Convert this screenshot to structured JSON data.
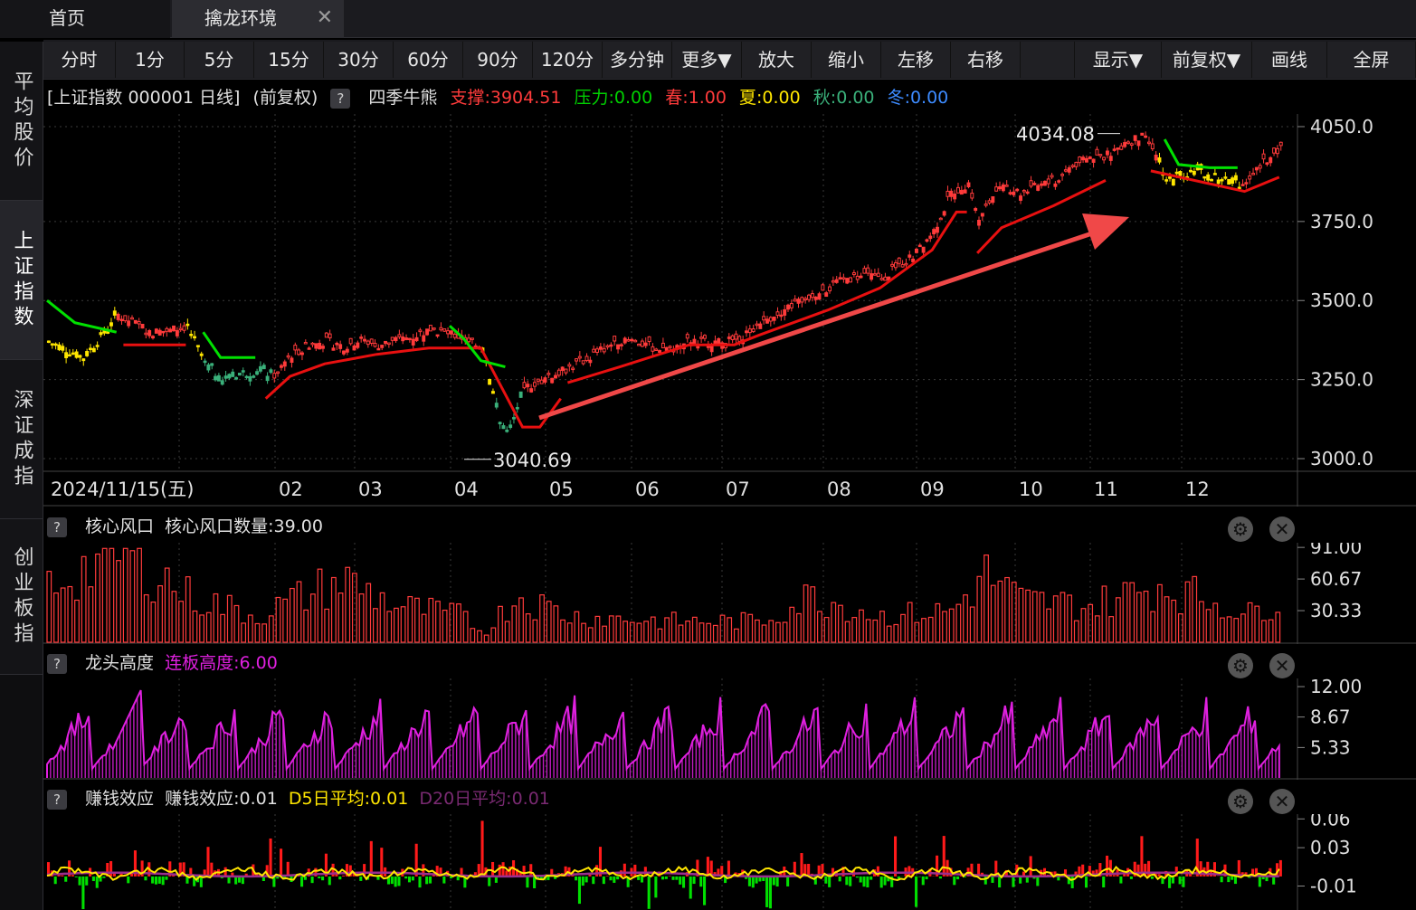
{
  "tabs": {
    "home": "首页",
    "active": "擒龙环境",
    "close": "✕"
  },
  "sidenav": [
    "平均股价",
    "上证指数",
    "深证成指",
    "创业板指"
  ],
  "toolbar": [
    "分时",
    "1分",
    "5分",
    "15分",
    "30分",
    "60分",
    "90分",
    "120分",
    "多分钟",
    "更多▼",
    "放大",
    "缩小",
    "左移",
    "右移",
    "",
    "显示▼",
    "前复权▼",
    "画线",
    "全屏"
  ],
  "main_header": {
    "title": "[上证指数 000001 日线]",
    "adj": "(前复权)",
    "help": "?",
    "indicator": "四季牛熊",
    "support": "支撑:3904.51",
    "pressure": "压力:0.00",
    "spring": "春:1.00",
    "summer": "夏:0.00",
    "autumn": "秋:0.00",
    "winter": "冬:0.00"
  },
  "colors": {
    "up": "#ff3b3b",
    "down_green": "#3ab07a",
    "yellow": "#ffe600",
    "green_line": "#00e000",
    "magenta": "#e020e0",
    "purple": "#9a2e8e",
    "arrow": "#f04848",
    "grid": "#3a3a3a"
  },
  "chart_data": [
    {
      "type": "candlestick",
      "title": "[上证指数 000001 日线]",
      "yaxis_ticks": [
        "4050.0",
        "3750.0",
        "3500.0",
        "3250.0",
        "3000.0"
      ],
      "ylim": [
        2960,
        4090
      ],
      "x_ticks": [
        "2024/11/15(五)",
        "02",
        "03",
        "04",
        "05",
        "06",
        "07",
        "08",
        "09",
        "10",
        "11",
        "12"
      ],
      "annotations": {
        "high": "4034.08",
        "low": "3040.69"
      },
      "close_path": [
        [
          0,
          3370
        ],
        [
          5,
          3345
        ],
        [
          10,
          3320
        ],
        [
          15,
          3385
        ],
        [
          20,
          3455
        ],
        [
          25,
          3425
        ],
        [
          30,
          3400
        ],
        [
          35,
          3405
        ],
        [
          40,
          3420
        ],
        [
          45,
          3300
        ],
        [
          50,
          3250
        ],
        [
          55,
          3270
        ],
        [
          60,
          3275
        ],
        [
          65,
          3265
        ],
        [
          70,
          3330
        ],
        [
          75,
          3360
        ],
        [
          80,
          3370
        ],
        [
          85,
          3355
        ],
        [
          90,
          3375
        ],
        [
          95,
          3360
        ],
        [
          100,
          3370
        ],
        [
          105,
          3385
        ],
        [
          110,
          3410
        ],
        [
          115,
          3395
        ],
        [
          120,
          3380
        ],
        [
          125,
          3360
        ],
        [
          130,
          3110
        ],
        [
          133,
          3090
        ],
        [
          137,
          3220
        ],
        [
          140,
          3240
        ],
        [
          145,
          3260
        ],
        [
          150,
          3290
        ],
        [
          155,
          3315
        ],
        [
          160,
          3350
        ],
        [
          165,
          3375
        ],
        [
          170,
          3365
        ],
        [
          175,
          3350
        ],
        [
          180,
          3350
        ],
        [
          185,
          3375
        ],
        [
          190,
          3370
        ],
        [
          195,
          3365
        ],
        [
          200,
          3390
        ],
        [
          205,
          3430
        ],
        [
          210,
          3460
        ],
        [
          215,
          3490
        ],
        [
          220,
          3520
        ],
        [
          225,
          3540
        ],
        [
          230,
          3570
        ],
        [
          235,
          3580
        ],
        [
          240,
          3570
        ],
        [
          245,
          3610
        ],
        [
          250,
          3650
        ],
        [
          255,
          3720
        ],
        [
          260,
          3840
        ],
        [
          265,
          3870
        ],
        [
          268,
          3760
        ],
        [
          272,
          3830
        ],
        [
          276,
          3860
        ],
        [
          280,
          3840
        ],
        [
          285,
          3860
        ],
        [
          290,
          3880
        ],
        [
          295,
          3930
        ],
        [
          300,
          3950
        ],
        [
          305,
          3960
        ],
        [
          310,
          4000
        ],
        [
          315,
          4015
        ],
        [
          318,
          3990
        ],
        [
          322,
          3880
        ],
        [
          326,
          3900
        ],
        [
          330,
          3910
        ],
        [
          335,
          3890
        ],
        [
          340,
          3880
        ],
        [
          344,
          3870
        ],
        [
          348,
          3910
        ],
        [
          352,
          3960
        ],
        [
          355,
          3990
        ]
      ],
      "support_line": [
        [
          22,
          3360
        ],
        [
          38,
          3360
        ],
        [
          40,
          3360
        ],
        [
          63,
          3190
        ],
        [
          70,
          3260
        ],
        [
          80,
          3300
        ],
        [
          95,
          3330
        ],
        [
          110,
          3350
        ],
        [
          125,
          3350
        ],
        [
          137,
          3100
        ],
        [
          142,
          3100
        ],
        [
          148,
          3190
        ],
        [
          150,
          3240
        ],
        [
          165,
          3290
        ],
        [
          185,
          3360
        ],
        [
          198,
          3360
        ],
        [
          205,
          3390
        ],
        [
          225,
          3470
        ],
        [
          240,
          3540
        ],
        [
          255,
          3660
        ],
        [
          262,
          3780
        ],
        [
          265,
          3780
        ],
        [
          268,
          3650
        ],
        [
          275,
          3730
        ],
        [
          290,
          3800
        ],
        [
          305,
          3880
        ],
        [
          318,
          3910
        ],
        [
          345,
          3845
        ],
        [
          355,
          3890
        ]
      ],
      "pressure_line": [
        [
          0,
          3500
        ],
        [
          8,
          3430
        ],
        [
          20,
          3400
        ],
        [
          45,
          3400
        ],
        [
          50,
          3320
        ],
        [
          60,
          3320
        ],
        [
          116,
          3420
        ],
        [
          120,
          3380
        ],
        [
          125,
          3310
        ],
        [
          132,
          3290
        ],
        [
          322,
          4010
        ],
        [
          326,
          3930
        ],
        [
          335,
          3920
        ],
        [
          343,
          3920
        ]
      ]
    },
    {
      "type": "bar",
      "title": "核心风口",
      "label": "核心风口数量:39.00",
      "yaxis_ticks": [
        "91.00",
        "60.67",
        "30.33"
      ],
      "ylim": [
        0,
        92
      ]
    },
    {
      "type": "area",
      "title": "龙头高度",
      "label": "连板高度:6.00",
      "yaxis_ticks": [
        "12.00",
        "8.67",
        "5.33"
      ],
      "ylim": [
        2,
        12.5
      ]
    },
    {
      "type": "bar",
      "title": "赚钱效应",
      "label": "赚钱效应:0.01",
      "d5": "D5日平均:0.01",
      "d20": "D20日平均:0.01",
      "yaxis_ticks": [
        "0.06",
        "0.03",
        "-0.01"
      ],
      "ylim": [
        -0.035,
        0.065
      ]
    }
  ]
}
